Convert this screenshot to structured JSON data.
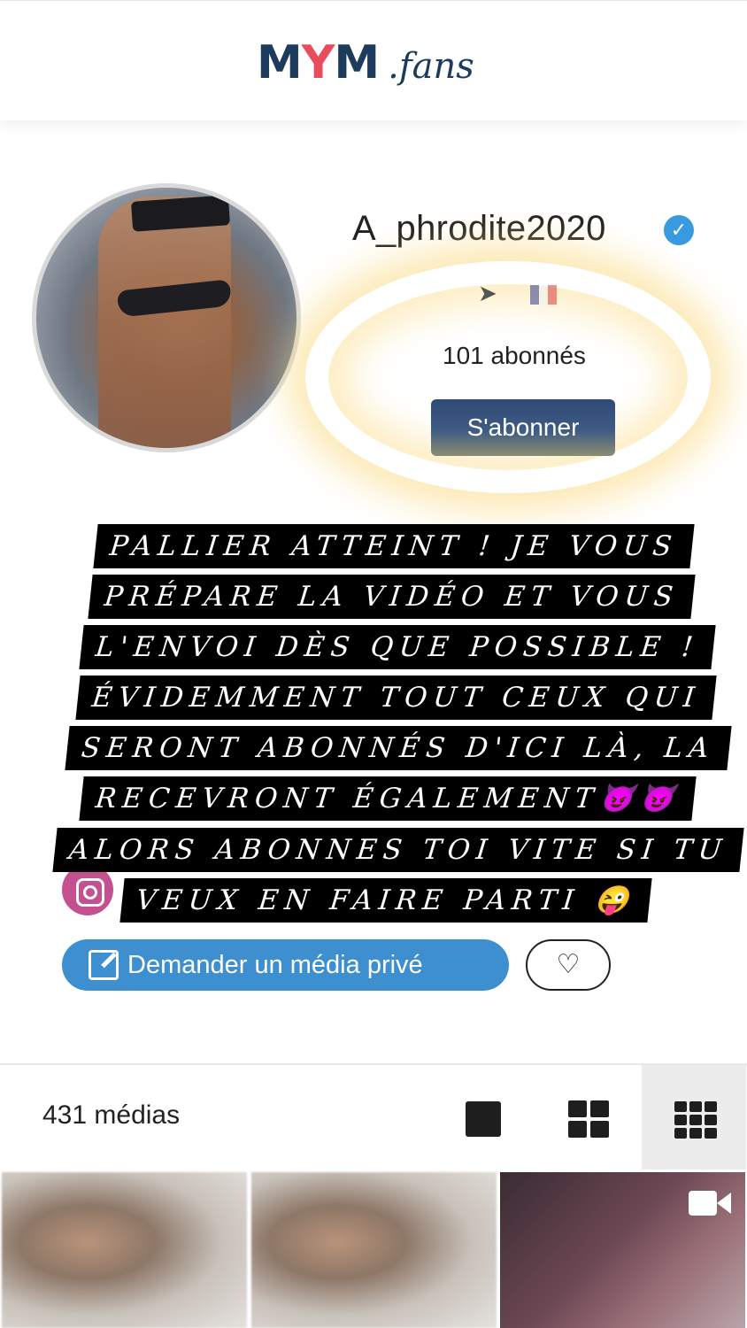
{
  "header": {
    "logo_main": "MYM",
    "logo_y": "Y",
    "logo_m1": "M",
    "logo_m2": "M",
    "logo_suffix": ".fans"
  },
  "profile": {
    "username": "A_phrodite2020",
    "verified": true,
    "location_icon": "location-arrow-icon",
    "flag_icon": "flag-icon",
    "subscribers": "101 abonnés",
    "subscribe_label": "S'abonner"
  },
  "overlay": {
    "lines": [
      "PALLIER ATTEINT ! JE VOUS",
      "PRÉPARE LA VIDÉO ET VOUS",
      "L'ENVOI DÈS QUE POSSIBLE !",
      "ÉVIDEMMENT TOUT CEUX QUI",
      "SERONT ABONNÉS D'ICI LÀ, LA",
      "RECEVRONT ÉGALEMENT😈😈",
      "ALORS ABONNES TOI VITE SI TU",
      "VEUX EN FAIRE PARTI 😜"
    ]
  },
  "actions": {
    "request_label": "Demander un média privé",
    "favorite_icon": "heart-icon"
  },
  "media": {
    "count": "431 médias",
    "views": [
      "grid-1-icon",
      "grid-2-icon",
      "grid-3-icon"
    ],
    "active_view": 2
  },
  "colors": {
    "brand_dark": "#1d3b5c",
    "brand_accent": "#e94c5b",
    "primary_blue": "#3d8fd0",
    "verified_blue": "#3a9ae0"
  }
}
